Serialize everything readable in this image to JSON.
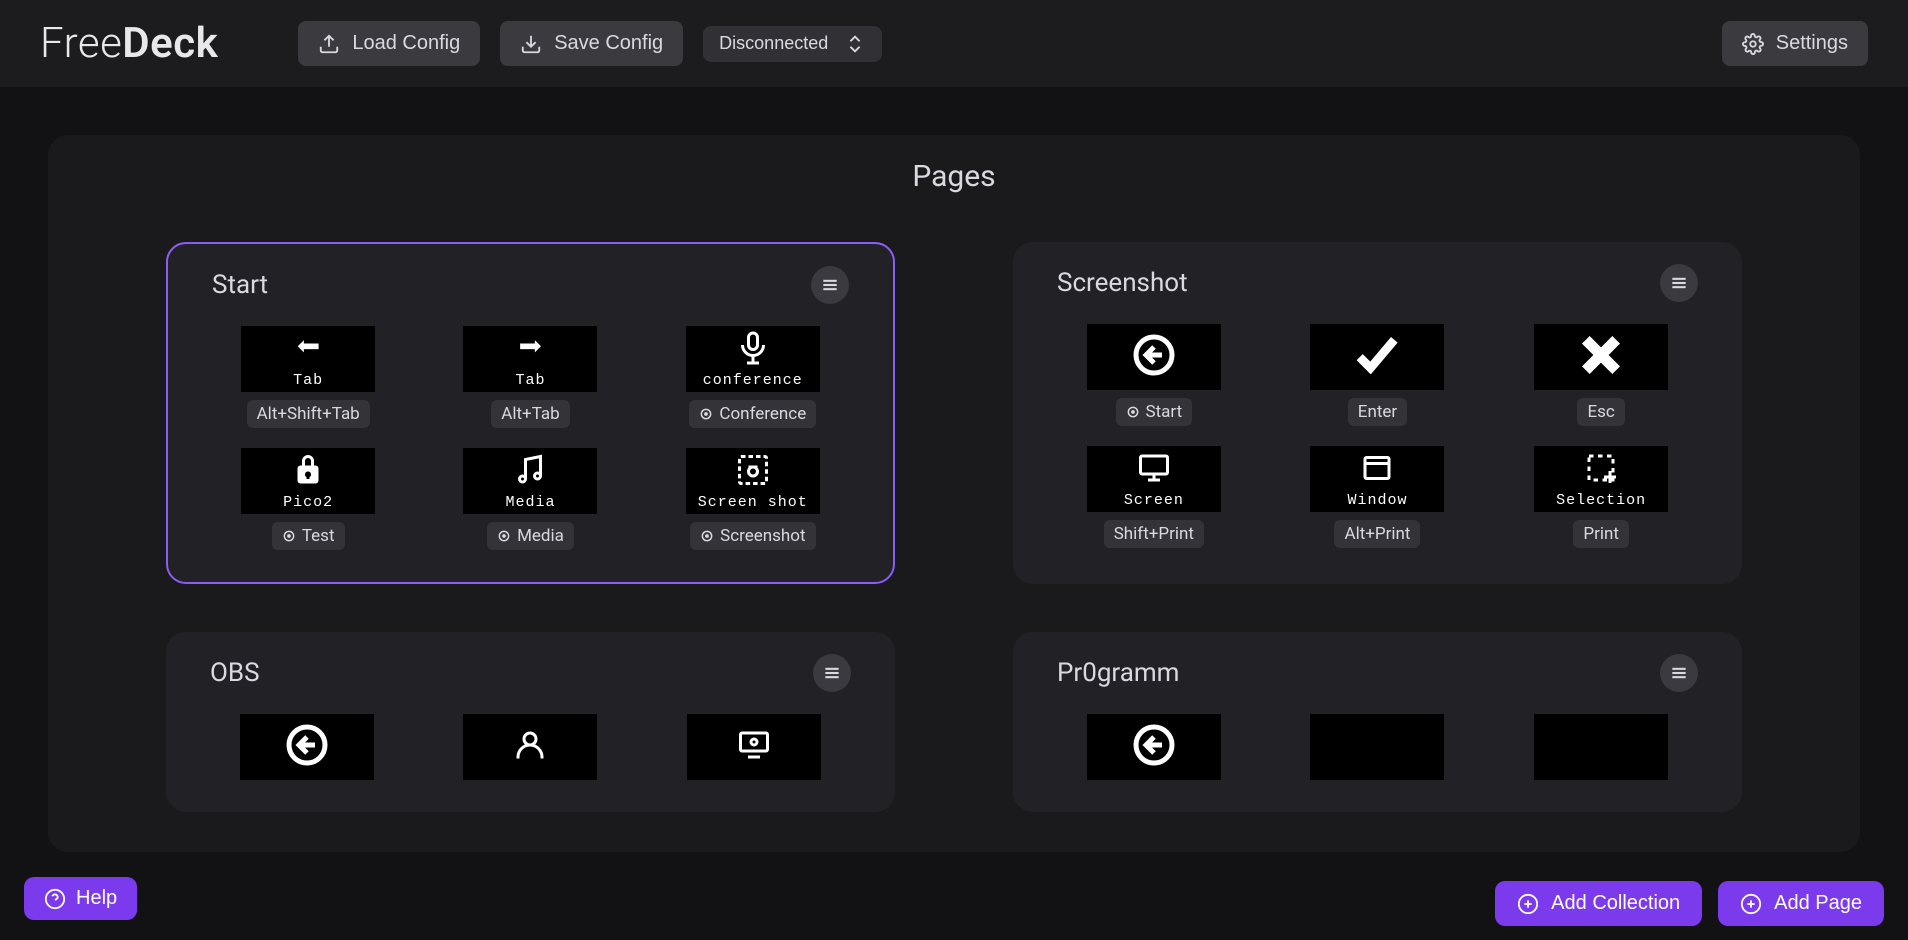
{
  "header": {
    "logo_part1": "Free",
    "logo_part2": "Deck",
    "load_label": "Load Config",
    "save_label": "Save Config",
    "connection_status": "Disconnected",
    "settings_label": "Settings"
  },
  "panel": {
    "title": "Pages"
  },
  "pages": [
    {
      "name": "Start",
      "active": true,
      "keys": [
        {
          "icon": "arrow-left",
          "img_label": "Tab",
          "badge": "Alt+Shift+Tab",
          "link": false
        },
        {
          "icon": "arrow-right",
          "img_label": "Tab",
          "badge": "Alt+Tab",
          "link": false
        },
        {
          "icon": "mic",
          "img_label": "conference",
          "badge": "Conference",
          "link": true
        },
        {
          "icon": "lock",
          "img_label": "Pico2",
          "badge": "Test",
          "link": true
        },
        {
          "icon": "music",
          "img_label": "Media",
          "badge": "Media",
          "link": true
        },
        {
          "icon": "screenshot",
          "img_label": "Screen shot",
          "badge": "Screenshot",
          "link": true
        }
      ]
    },
    {
      "name": "Screenshot",
      "active": false,
      "keys": [
        {
          "icon": "back-circle",
          "img_label": "",
          "badge": "Start",
          "link": true
        },
        {
          "icon": "check",
          "img_label": "",
          "badge": "Enter",
          "link": false
        },
        {
          "icon": "x",
          "img_label": "",
          "badge": "Esc",
          "link": false
        },
        {
          "icon": "monitor",
          "img_label": "Screen",
          "badge": "Shift+Print",
          "link": false
        },
        {
          "icon": "window",
          "img_label": "Window",
          "badge": "Alt+Print",
          "link": false
        },
        {
          "icon": "selection",
          "img_label": "Selection",
          "badge": "Print",
          "link": false
        }
      ]
    },
    {
      "name": "OBS",
      "active": false,
      "keys": [
        {
          "icon": "back-circle",
          "img_label": "",
          "badge": "",
          "link": false
        },
        {
          "icon": "person",
          "img_label": "",
          "badge": "",
          "link": false
        },
        {
          "icon": "screen-share",
          "img_label": "",
          "badge": "",
          "link": false
        }
      ]
    },
    {
      "name": "Pr0gramm",
      "active": false,
      "keys": [
        {
          "icon": "back-circle",
          "img_label": "",
          "badge": "",
          "link": false
        },
        {
          "icon": "blank",
          "img_label": "",
          "badge": "",
          "link": false
        },
        {
          "icon": "blank",
          "img_label": "",
          "badge": "",
          "link": false
        }
      ]
    }
  ],
  "footer": {
    "help_label": "Help",
    "add_collection_label": "Add Collection",
    "add_page_label": "Add Page"
  }
}
